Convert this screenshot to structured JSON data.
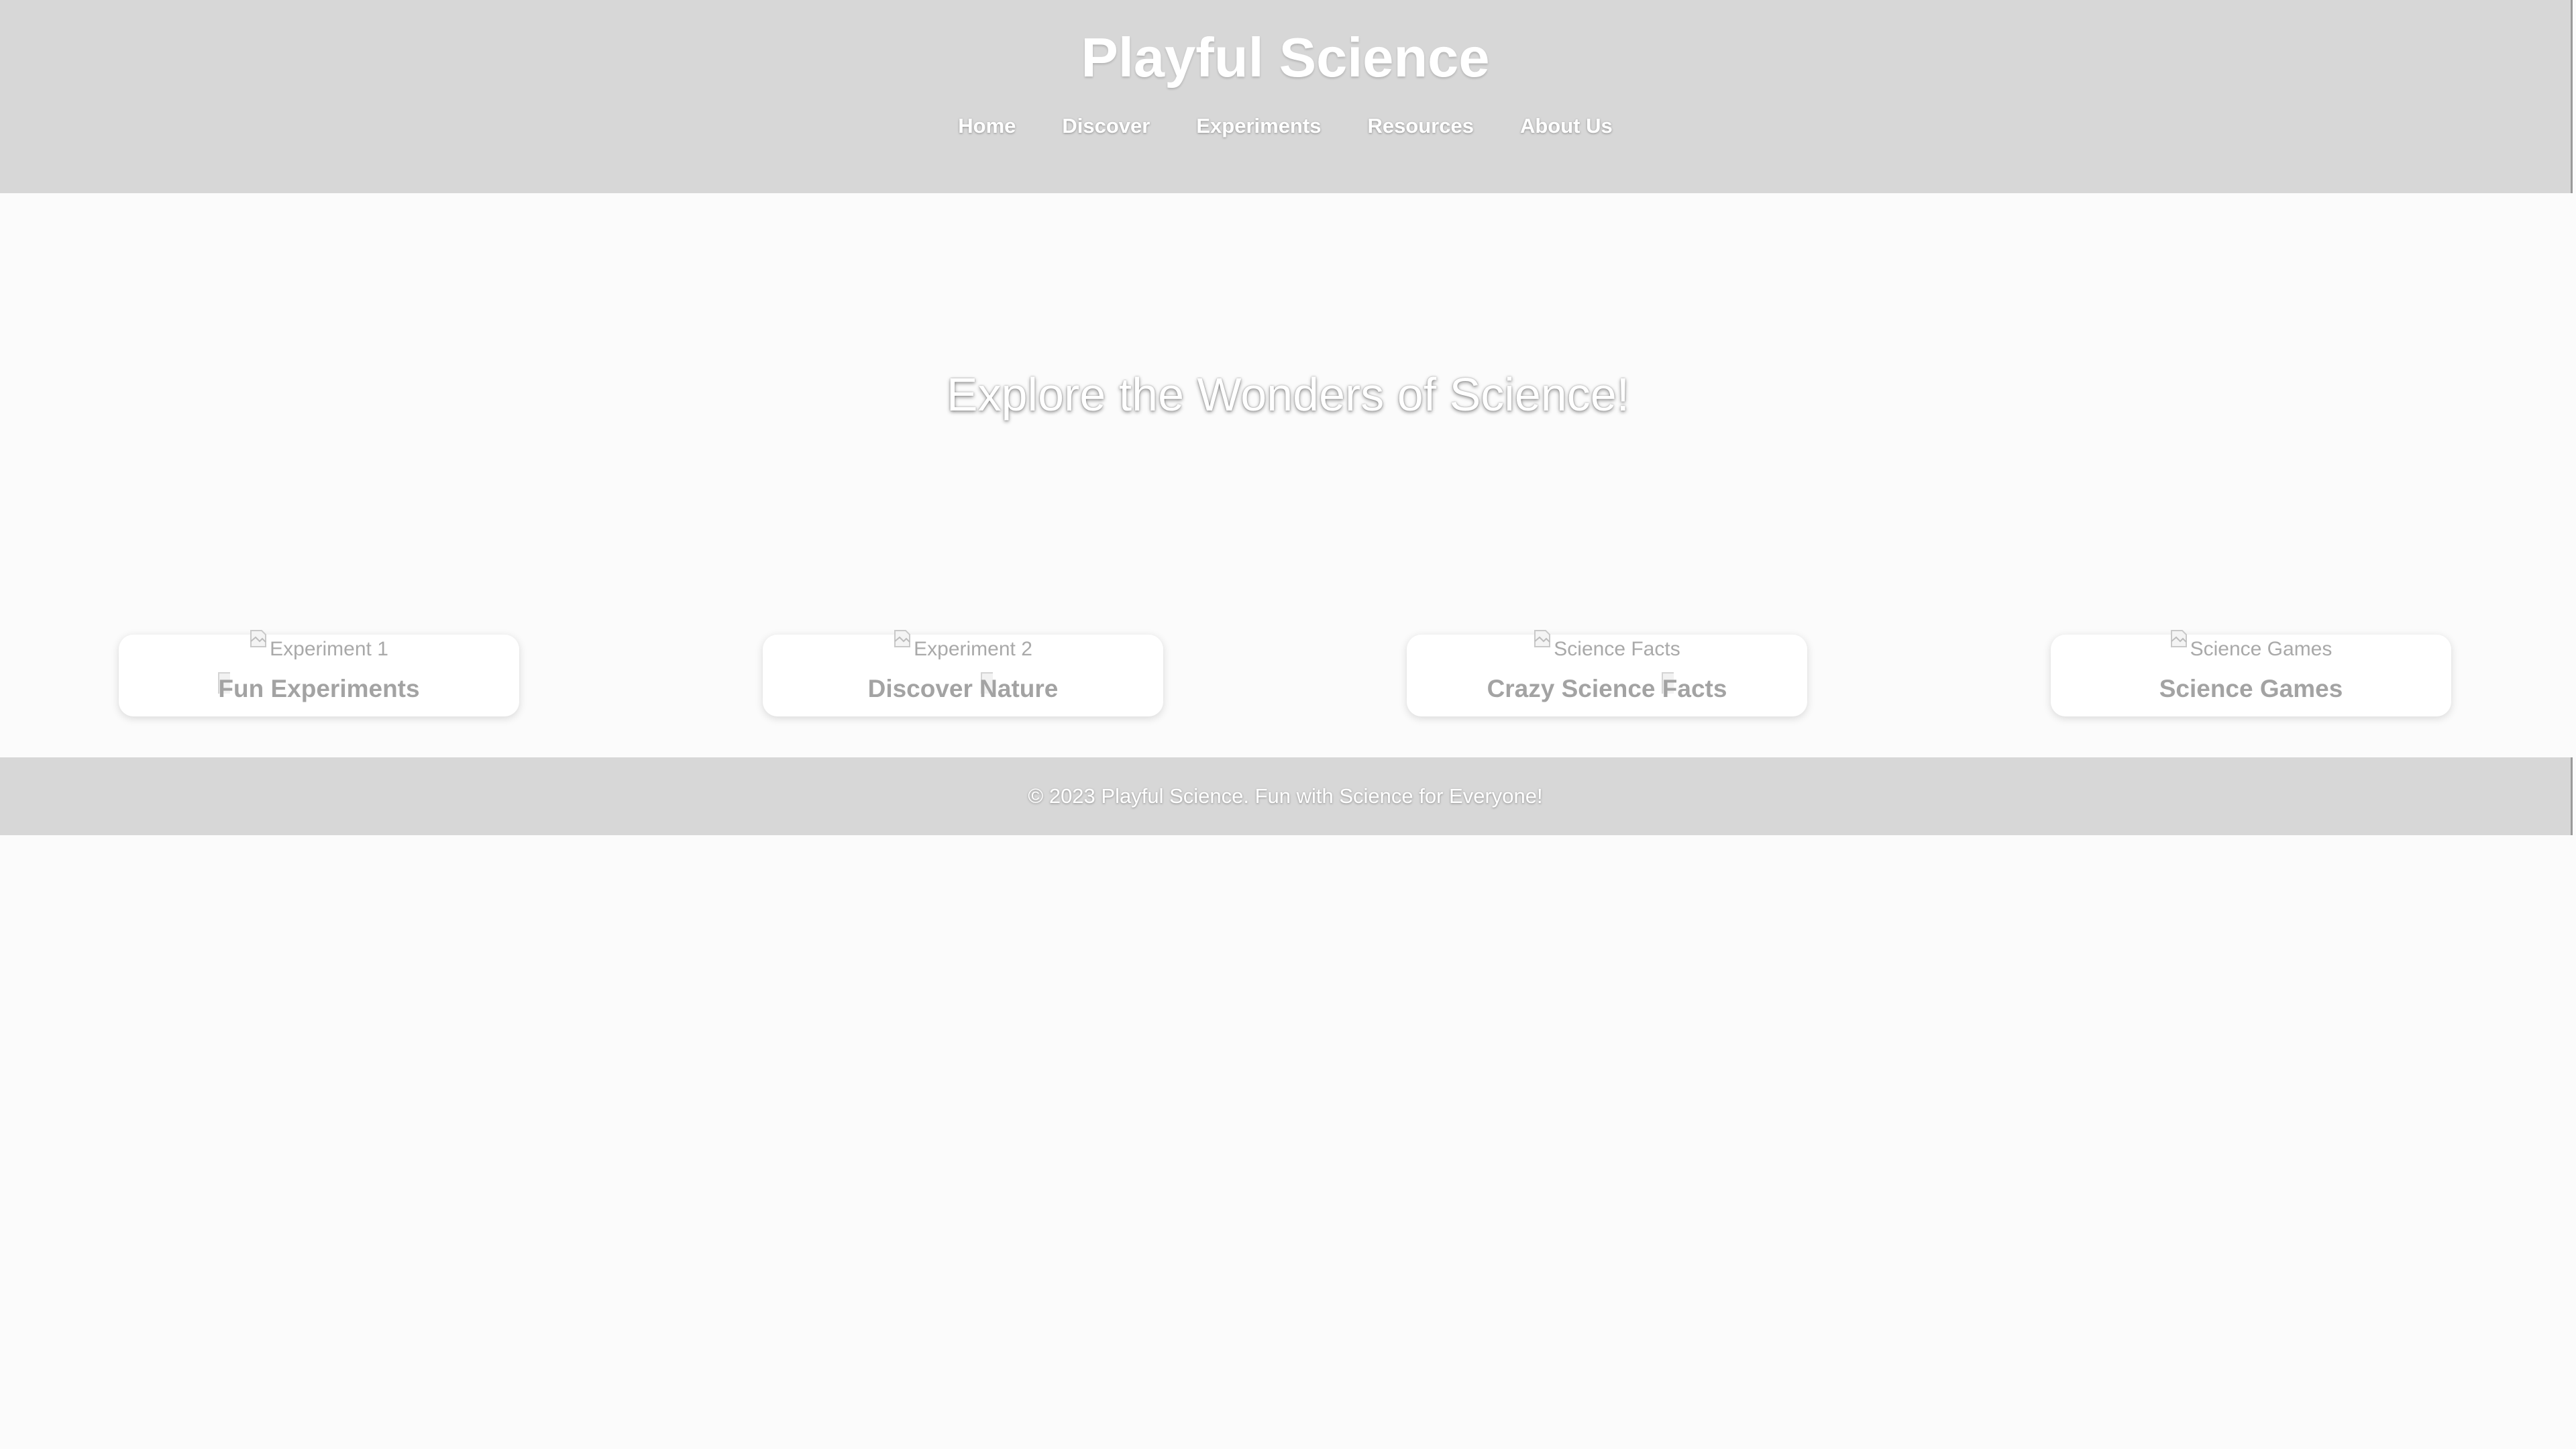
{
  "header": {
    "title": "Playful Science",
    "nav": [
      {
        "label": "Home"
      },
      {
        "label": "Discover"
      },
      {
        "label": "Experiments"
      },
      {
        "label": "Resources"
      },
      {
        "label": "About Us"
      }
    ]
  },
  "hero": {
    "title": "Explore the Wonders of Science!"
  },
  "cards": [
    {
      "image_alt": "Experiment 1",
      "title": "Fun Experiments",
      "icon": "broken-image-icon"
    },
    {
      "image_alt": "Experiment 2",
      "title": "Discover Nature",
      "icon": "broken-image-icon"
    },
    {
      "image_alt": "Science Facts",
      "title": "Crazy Science Facts",
      "icon": "broken-image-icon"
    },
    {
      "image_alt": "Science Games",
      "title": "Science Games",
      "icon": "broken-image-icon"
    }
  ],
  "footer": {
    "text": "© 2023 Playful Science. Fun with Science for Everyone!"
  },
  "colors": {
    "header_bg": "#d7d7d7",
    "page_bg": "#fbfbfb",
    "card_bg": "#ffffff",
    "muted_text": "#a3a3a3"
  }
}
